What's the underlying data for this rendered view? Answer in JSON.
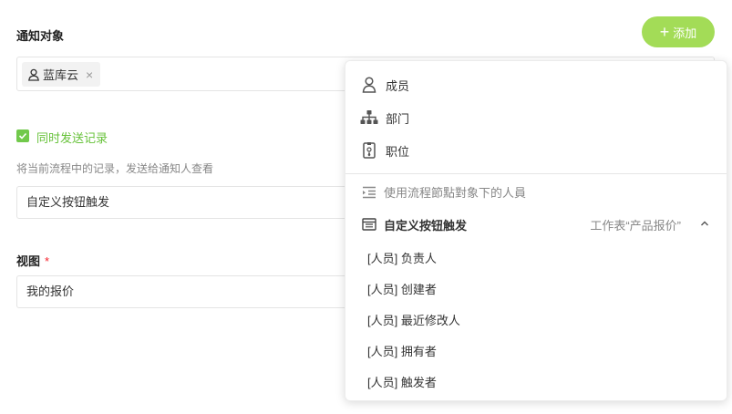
{
  "notify": {
    "label": "通知对象",
    "add_button": "添加",
    "recipient_chip": "蓝库云",
    "remove_symbol": "×"
  },
  "record": {
    "checkbox_label": "同时发送记录",
    "checked": true,
    "hint": "将当前流程中的记录，发送给通知人查看",
    "trigger_value": "自定义按钮触发"
  },
  "view": {
    "label": "视图",
    "required_mark": "*",
    "value": "我的报价"
  },
  "dropdown": {
    "options": [
      {
        "label": "成员",
        "icon": "person-icon"
      },
      {
        "label": "部门",
        "icon": "org-chart-icon"
      },
      {
        "label": "职位",
        "icon": "badge-icon"
      }
    ],
    "workflow_node_label": "使用流程節點對象下的人員",
    "group": {
      "title": "自定义按钮触发",
      "source": "工作表“产品报价”",
      "expanded": true,
      "items": [
        "[人员] 负责人",
        "[人员] 创建者",
        "[人员] 最近修改人",
        "[人员] 拥有者",
        "[人员] 触发者"
      ]
    }
  },
  "colors": {
    "accent_green": "#a3dc57",
    "check_green": "#67c23a",
    "required_red": "#f5222d"
  }
}
